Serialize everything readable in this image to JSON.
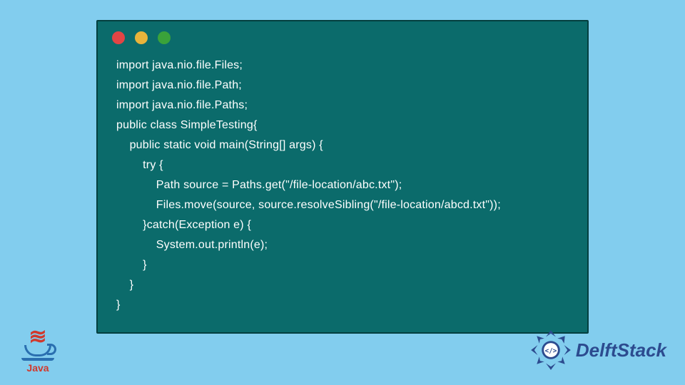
{
  "code": {
    "lines": [
      "import java.nio.file.Files;",
      "import java.nio.file.Path;",
      "import java.nio.file.Paths;",
      "public class SimpleTesting{",
      "    public static void main(String[] args) {",
      "        try {",
      "            Path source = Paths.get(\"/file-location/abc.txt\");",
      "            Files.move(source, source.resolveSibling(\"/file-location/abcd.txt\"));",
      "        }catch(Exception e) {",
      "            System.out.println(e);",
      "        }",
      "    }",
      "}"
    ]
  },
  "logos": {
    "java_label": "Java",
    "delft_label": "DelftStack"
  },
  "window": {
    "dots": [
      "red",
      "yellow",
      "green"
    ]
  }
}
